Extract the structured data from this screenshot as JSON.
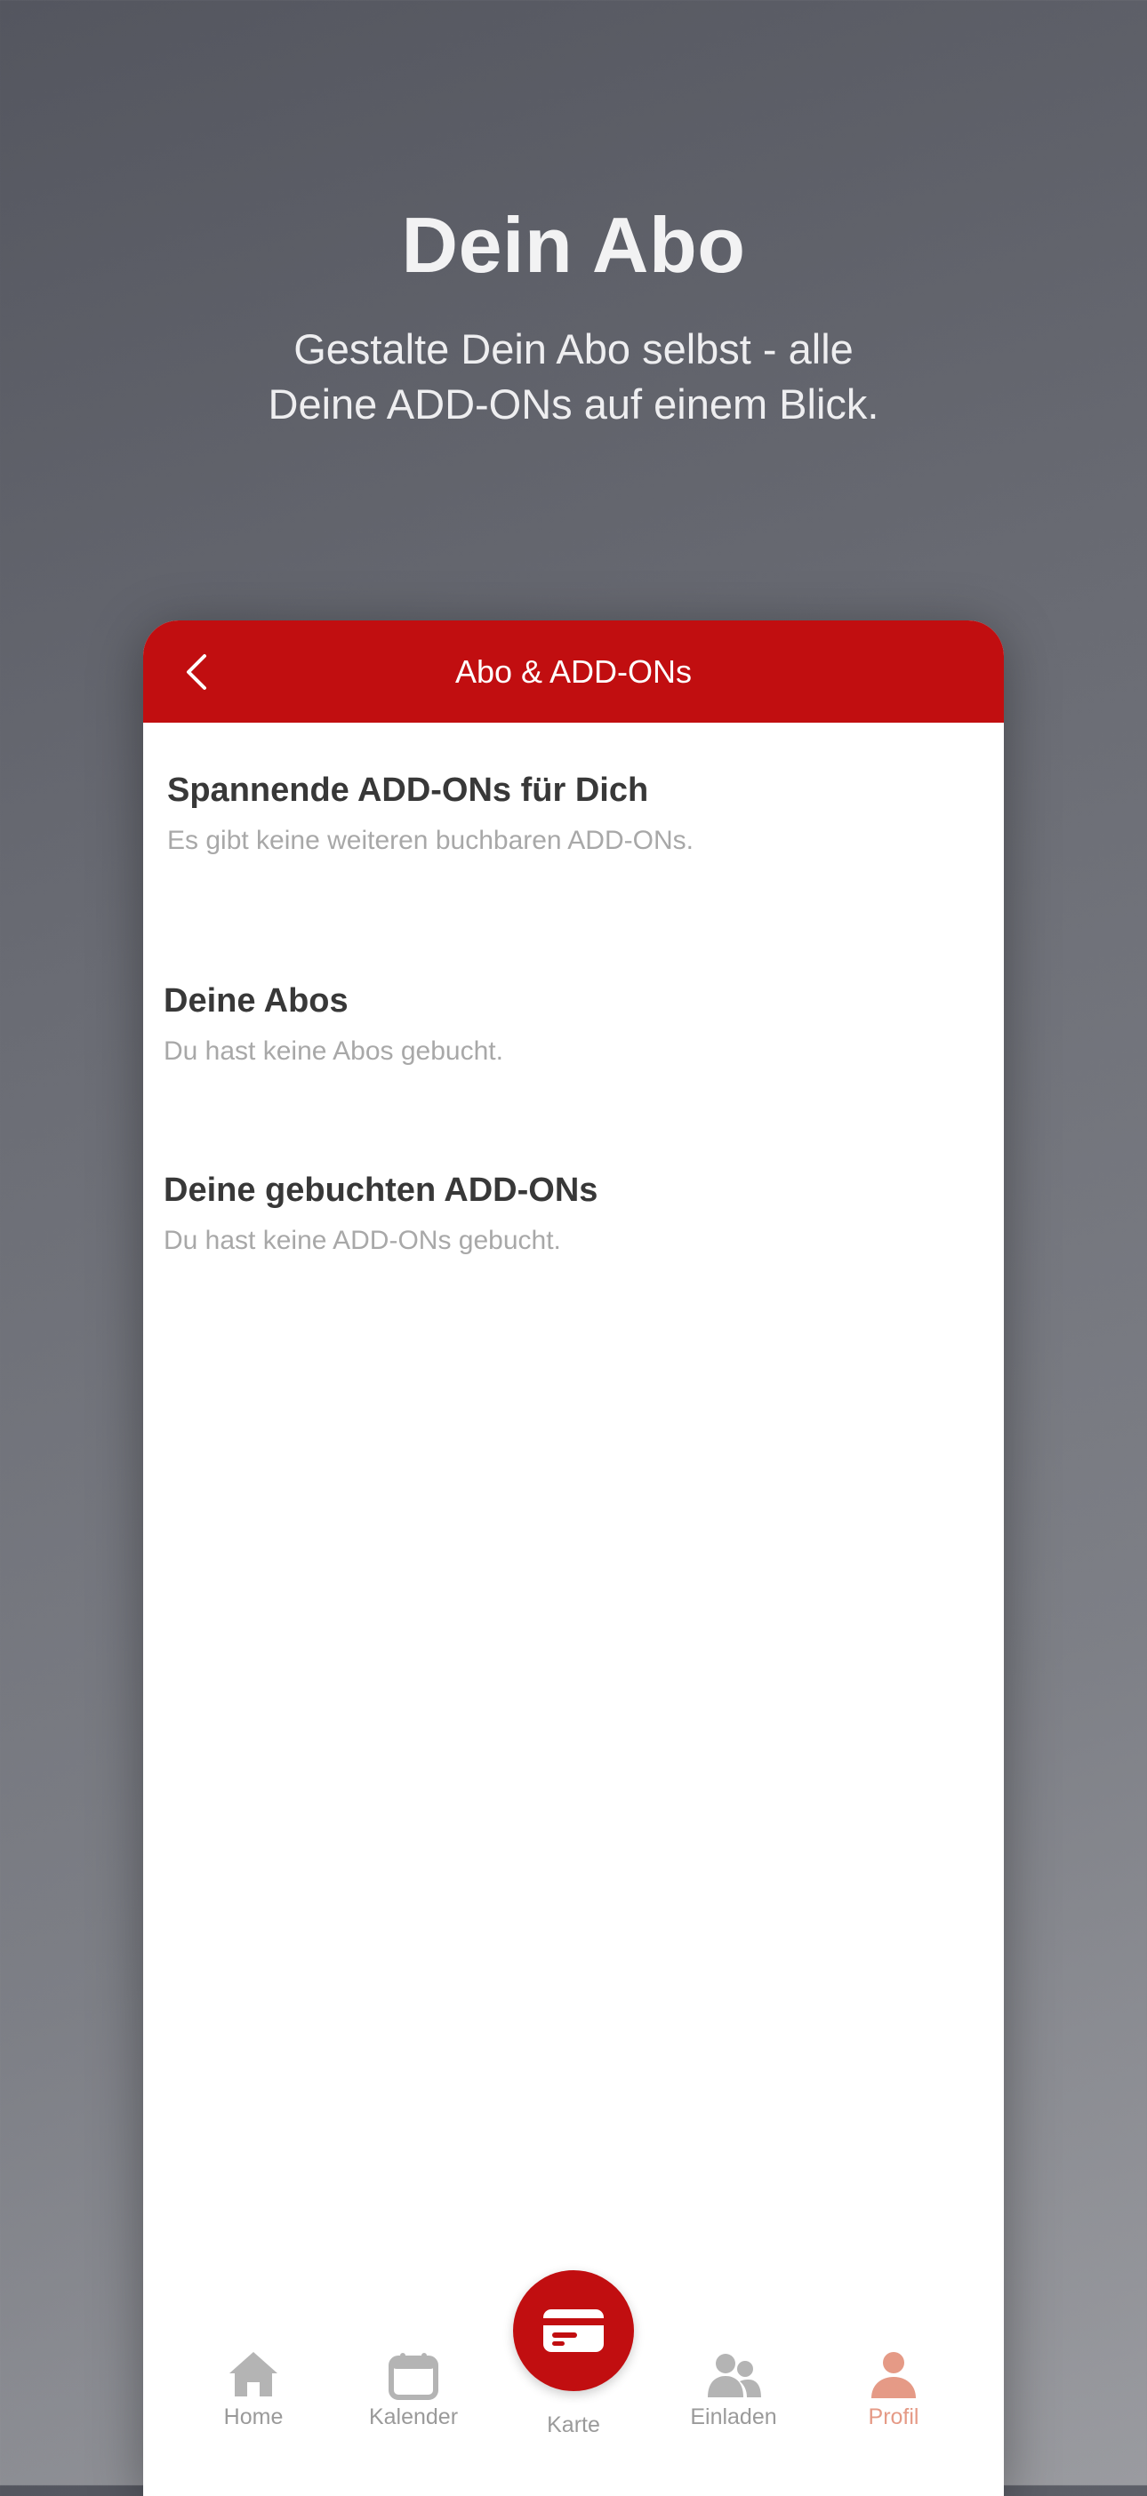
{
  "hero": {
    "title": "Dein Abo",
    "subtitle_line1": "Gestalte Dein Abo selbst - alle",
    "subtitle_line2": "Deine ADD-ONs auf einem Blick."
  },
  "screen": {
    "nav_title": "Abo & ADD-ONs",
    "sections": [
      {
        "title": "Spannende ADD-ONs für Dich",
        "description": "Es gibt keine weiteren buchbaren ADD-ONs."
      },
      {
        "title": "Deine Abos",
        "description": "Du hast keine Abos gebucht."
      },
      {
        "title": "Deine gebuchten ADD-ONs",
        "description": "Du hast keine ADD-ONs gebucht."
      }
    ]
  },
  "tabbar": {
    "items": [
      {
        "label": "Home",
        "icon": "home-icon"
      },
      {
        "label": "Kalender",
        "icon": "calendar-icon"
      },
      {
        "label": "Karte",
        "icon": "card-icon"
      },
      {
        "label": "Einladen",
        "icon": "people-icon"
      },
      {
        "label": "Profil",
        "icon": "person-icon",
        "active": true
      }
    ]
  },
  "colors": {
    "brand_red": "#c10e10",
    "active_tab": "#e59a86",
    "inactive_tab": "#9a9a9a"
  }
}
